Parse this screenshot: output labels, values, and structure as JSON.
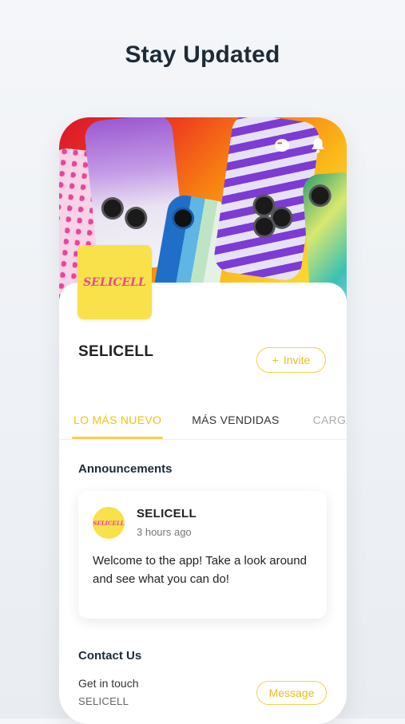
{
  "headline": "Stay Updated",
  "cover": {
    "logo_text": "SELICELL",
    "icons": [
      "chat-icon",
      "bell-icon"
    ]
  },
  "site": {
    "name": "SELICELL"
  },
  "invite_button": {
    "icon": "+",
    "label": "Invite"
  },
  "tabs": [
    {
      "label": "LO MÁS NUEVO",
      "active": true
    },
    {
      "label": "MÁS VENDIDAS",
      "active": false
    },
    {
      "label": "CARGA",
      "active": false
    }
  ],
  "announcements": {
    "title": "Announcements",
    "post": {
      "avatar_text": "SELICELL",
      "author": "SELICELL",
      "time": "3 hours ago",
      "message": "Welcome to the app! Take a look around and see what you can do!"
    }
  },
  "contact": {
    "title": "Contact Us",
    "subtitle": "Get in touch",
    "name": "SELICELL",
    "button_label": "Message"
  },
  "colors": {
    "accent": "#f2cf3b",
    "logo_bg": "#f8e14a",
    "logo_text": "#e8479b"
  }
}
